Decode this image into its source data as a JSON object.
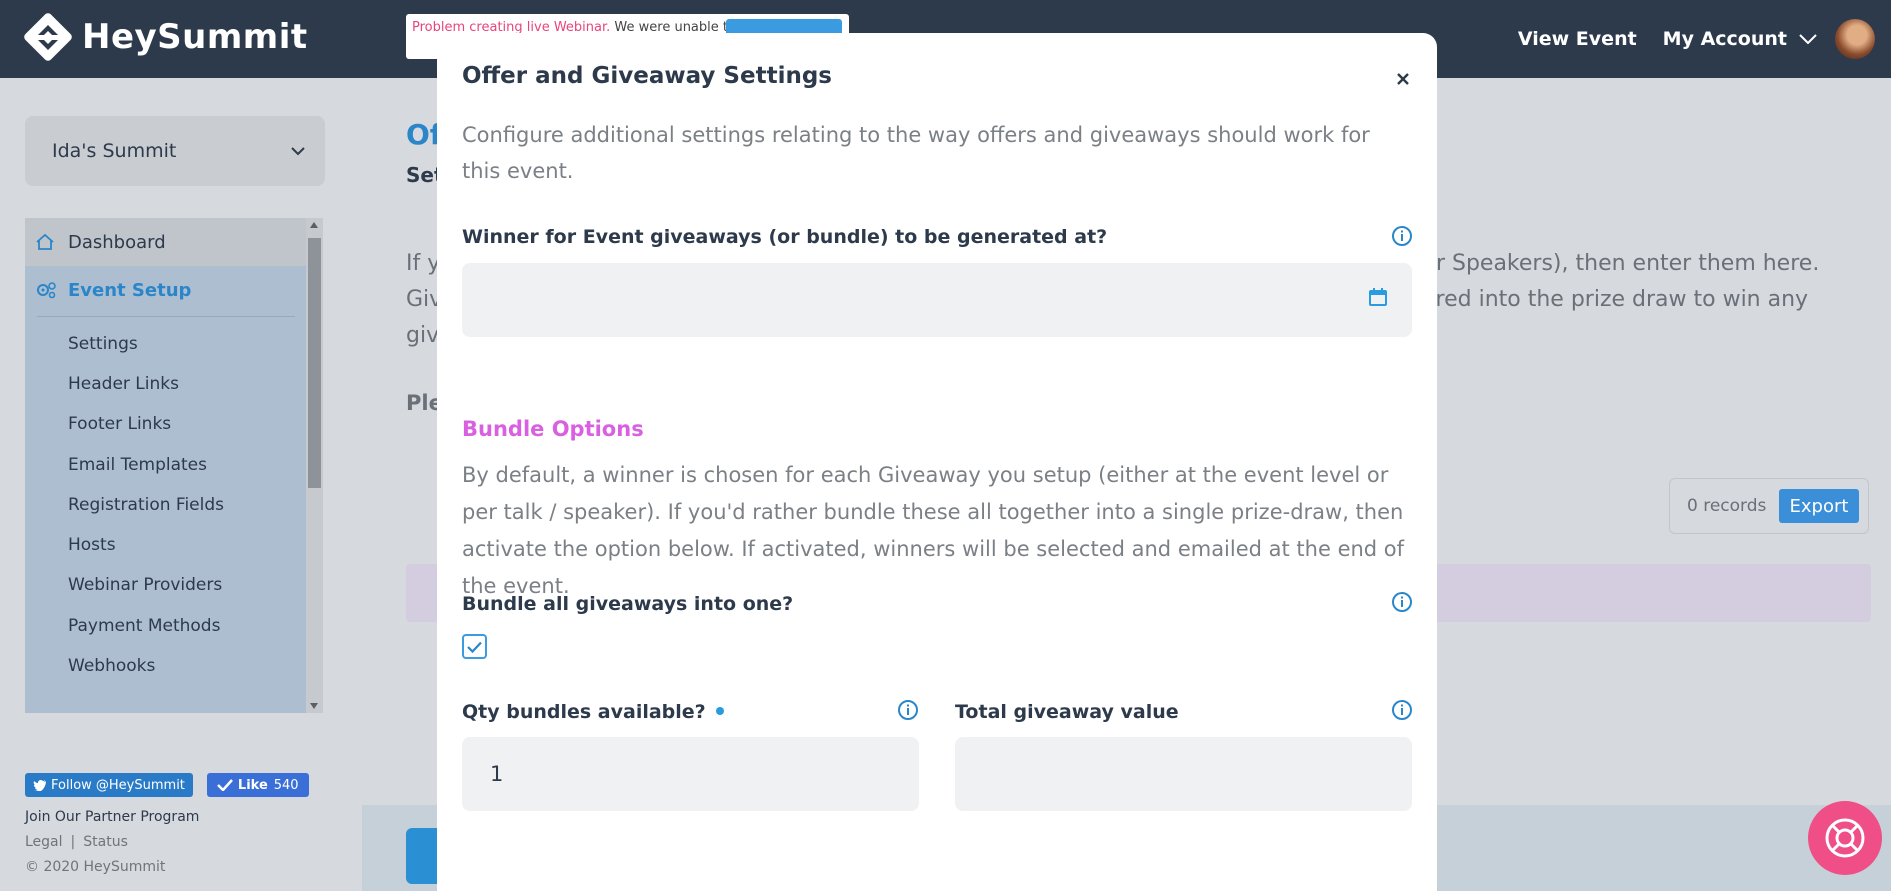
{
  "app": {
    "logo_text": "HeySummit",
    "nav_view_event": "View Event",
    "nav_my_account": "My Account"
  },
  "alert": {
    "error_text": "Problem creating live Webinar.",
    "message": " We were unable to cr"
  },
  "sidebar": {
    "summit_name": "Ida's Summit",
    "items": [
      {
        "label": "Dashboard"
      },
      {
        "label": "Event Setup"
      }
    ],
    "subitems": [
      {
        "label": "Settings"
      },
      {
        "label": "Header Links"
      },
      {
        "label": "Footer Links"
      },
      {
        "label": "Email Templates"
      },
      {
        "label": "Registration Fields"
      },
      {
        "label": "Hosts"
      },
      {
        "label": "Webinar Providers"
      },
      {
        "label": "Payment Methods"
      },
      {
        "label": "Webhooks"
      }
    ],
    "twitter_follow": "Follow @HeySummit",
    "fb_like": "Like",
    "fb_count": "540",
    "partner_program": "Join Our Partner Program",
    "legal": "Legal",
    "status": "Status",
    "copyright": "© 2020 HeySummit"
  },
  "background_page": {
    "title_fragment": "Of",
    "subtitle_fragment": "Set",
    "para_left": "If y\nGiv\ngiv",
    "para_right": "ur Speakers), then enter them here.\nered into the prize draw to win any",
    "ple_fragment": "Ple",
    "records_count": "0 records",
    "export_label": "Export"
  },
  "modal": {
    "title": "Offer and Giveaway Settings",
    "description": "Configure additional settings relating to the way offers and giveaways should work for this event.",
    "winner_label": "Winner for Event giveaways (or bundle) to be generated at?",
    "winner_value": "",
    "bundle_section_title": "Bundle Options",
    "bundle_description": "By default, a winner is chosen for each Giveaway you setup (either at the event level or per talk / speaker). If you'd rather bundle these all together into a single prize-draw, then activate the option below. If activated, winners will be selected and emailed at the end of the event.",
    "bundle_all_label": "Bundle all giveaways into one?",
    "bundle_all_checked": true,
    "qty_label": "Qty bundles available?",
    "qty_value": "1",
    "total_value_label": "Total giveaway value",
    "total_value": ""
  },
  "colors": {
    "topbar": "#2d3a4b",
    "accent": "#2a86c9",
    "section_title": "#d960e0",
    "help_button": "#ef4f86"
  }
}
